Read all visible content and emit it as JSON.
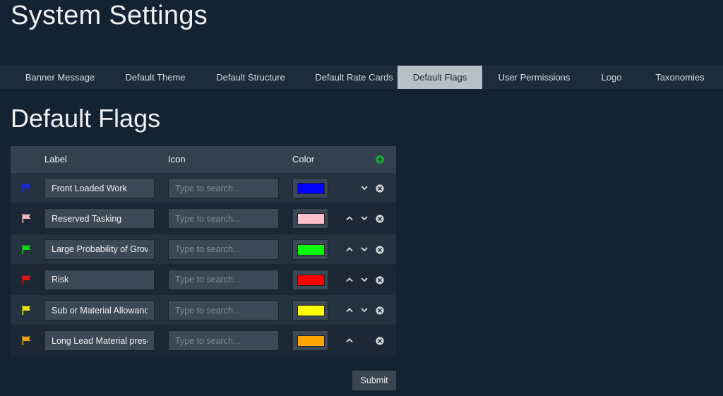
{
  "header": {
    "title": "System Settings"
  },
  "tabs": [
    {
      "label": "Banner Message",
      "active": false
    },
    {
      "label": "Default Theme",
      "active": false
    },
    {
      "label": "Default Structure",
      "active": false
    },
    {
      "label": "Default Rate Cards",
      "active": false
    },
    {
      "label": "Default Flags",
      "active": true
    },
    {
      "label": "User Permissions",
      "active": false
    },
    {
      "label": "Logo",
      "active": false
    },
    {
      "label": "Taxonomies",
      "active": false
    }
  ],
  "section": {
    "title": "Default Flags"
  },
  "table": {
    "columns": {
      "label": "Label",
      "icon": "Icon",
      "color": "Color"
    },
    "icon_placeholder": "Type to search...",
    "rows": [
      {
        "label": "Front Loaded Work",
        "color": "#0000ff",
        "flag_color": "#1a2bd8",
        "show_up": false,
        "show_down": true
      },
      {
        "label": "Reserved Tasking",
        "color": "#ffc0cb",
        "flag_color": "#f4b4c0",
        "show_up": true,
        "show_down": true
      },
      {
        "label": "Large Probability of Grow",
        "color": "#00ff00",
        "flag_color": "#14d414",
        "show_up": true,
        "show_down": true
      },
      {
        "label": "Risk",
        "color": "#ff0000",
        "flag_color": "#e01414",
        "show_up": true,
        "show_down": true
      },
      {
        "label": "Sub or Material Allowanc",
        "color": "#ffff00",
        "flag_color": "#e8e214",
        "show_up": true,
        "show_down": true
      },
      {
        "label": "Long Lead Material prese",
        "color": "#ffa500",
        "flag_color": "#f0a014",
        "show_up": true,
        "show_down": false
      }
    ]
  },
  "icons": {
    "flag": "flag-icon",
    "up": "chevron-up-icon",
    "down": "chevron-down-icon",
    "remove": "close-circle-icon",
    "add": "plus-circle-icon"
  },
  "colors": {
    "add": "#1f9d3a"
  },
  "actions": {
    "submit_label": "Submit"
  }
}
